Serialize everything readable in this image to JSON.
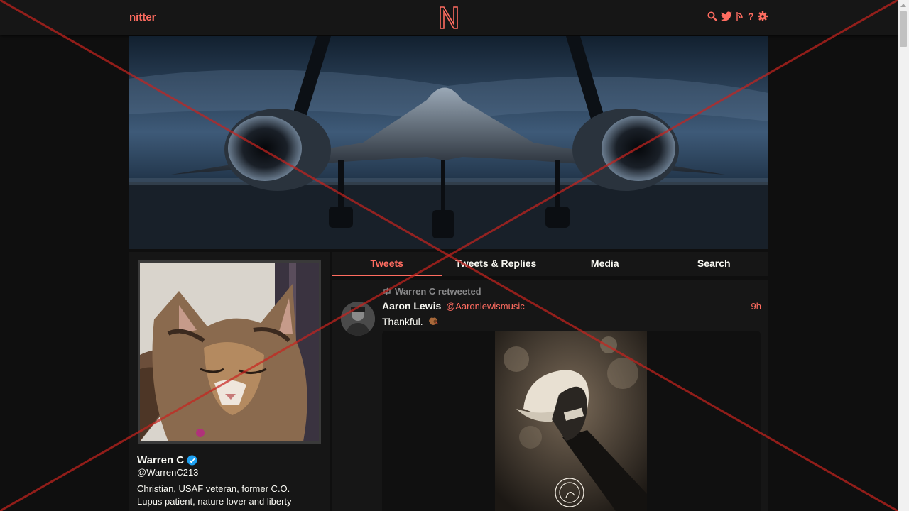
{
  "nav": {
    "brand": "nitter",
    "logo_letter": "N",
    "icons": [
      "search-icon",
      "twitter-icon",
      "rss-icon",
      "help-icon",
      "gear-icon"
    ]
  },
  "profile": {
    "fullname": "Warren C",
    "verified": true,
    "username": "@WarrenC213",
    "bio_line1": "Christian, USAF veteran, former C.O.",
    "bio_line2": "Lupus patient, nature lover and liberty"
  },
  "tabs": [
    {
      "label": "Tweets",
      "active": true
    },
    {
      "label": "Tweets & Replies",
      "active": false
    },
    {
      "label": "Media",
      "active": false
    },
    {
      "label": "Search",
      "active": false
    }
  ],
  "tweet": {
    "retweet_header": "Warren C retweeted",
    "fullname": "Aaron Lewis",
    "username": "@Aaronlewismusic",
    "date": "9h",
    "text": "Thankful."
  },
  "colors": {
    "accent": "#ff6c60",
    "background": "#0f0f0f",
    "panel": "#161616",
    "muted": "#888889"
  }
}
